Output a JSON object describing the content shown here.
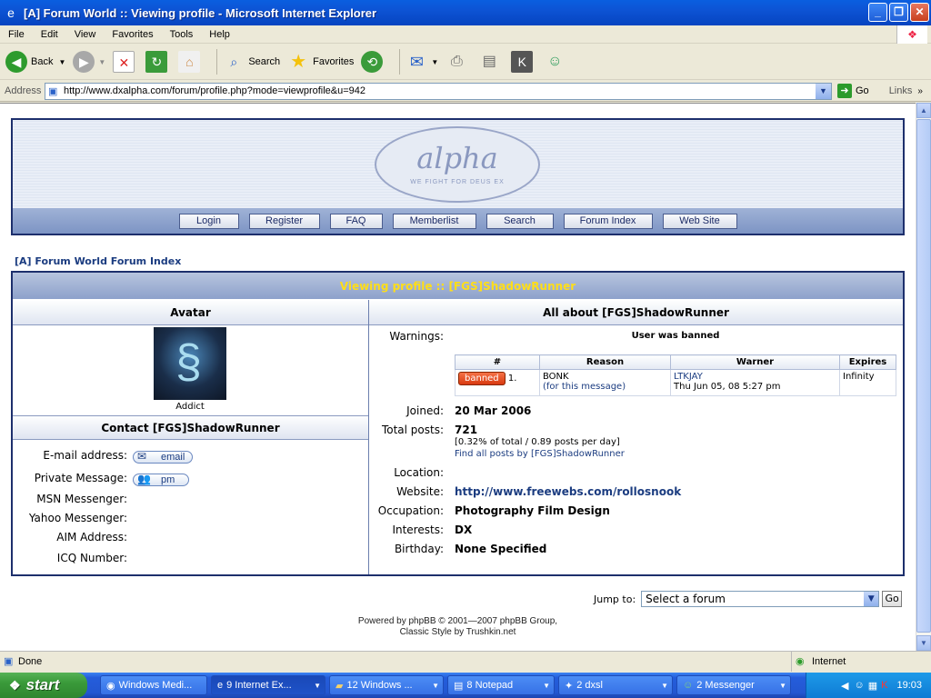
{
  "window": {
    "title": "[A] Forum World :: Viewing profile - Microsoft Internet Explorer"
  },
  "menu": [
    "File",
    "Edit",
    "View",
    "Favorites",
    "Tools",
    "Help"
  ],
  "toolbar": {
    "back": "Back",
    "search": "Search",
    "favorites": "Favorites"
  },
  "address": {
    "label": "Address",
    "url": "http://www.dxalpha.com/forum/profile.php?mode=viewprofile&u=942",
    "go": "Go",
    "links": "Links"
  },
  "site": {
    "logo_text": "alpha",
    "logo_slogan": "WE FIGHT FOR DEUS EX",
    "nav": [
      "Login",
      "Register",
      "FAQ",
      "Memberlist",
      "Search",
      "Forum Index",
      "Web Site"
    ],
    "index_link": "[A] Forum World Forum Index"
  },
  "profile": {
    "heading": "Viewing profile :: [FGS]ShadowRunner",
    "avatar_header": "Avatar",
    "rank": "Addict",
    "contact_header": "Contact [FGS]ShadowRunner",
    "contact": {
      "email_label": "E-mail address:",
      "email_btn": "email",
      "pm_label": "Private Message:",
      "pm_btn": "pm",
      "msn_label": "MSN Messenger:",
      "yahoo_label": "Yahoo Messenger:",
      "aim_label": "AIM Address:",
      "icq_label": "ICQ Number:"
    },
    "about_header": "All about [FGS]ShadowRunner",
    "warnings_label": "Warnings:",
    "warnings_status": "User was banned",
    "warn_table": {
      "headers": [
        "#",
        "Reason",
        "Warner",
        "Expires"
      ],
      "row": {
        "badge": "banned",
        "num": "1.",
        "reason": "BONK",
        "reason_link": "(for this message)",
        "warner": "LTKJAY",
        "warner_date": "Thu Jun 05, 08 5:27 pm",
        "expires": "Infinity"
      }
    },
    "joined_label": "Joined:",
    "joined": "20 Mar 2006",
    "posts_label": "Total posts:",
    "posts": "721",
    "posts_detail": "[0.32% of total / 0.89 posts per day]",
    "posts_link": "Find all posts by [FGS]ShadowRunner",
    "location_label": "Location:",
    "website_label": "Website:",
    "website": "http://www.freewebs.com/rollosnook",
    "occupation_label": "Occupation:",
    "occupation": "Photography Film Design",
    "interests_label": "Interests:",
    "interests": "DX",
    "birthday_label": "Birthday:",
    "birthday": "None Specified"
  },
  "jump": {
    "label": "Jump to:",
    "selected": "Select a forum",
    "go": "Go"
  },
  "footer": {
    "line1": "Powered by phpBB © 2001—2007 phpBB Group,",
    "line2": "Classic Style by Trushkin.net"
  },
  "status": {
    "text": "Done",
    "zone": "Internet"
  },
  "taskbar": {
    "start": "start",
    "tasks": [
      "Windows Medi...",
      "9 Internet Ex...",
      "12 Windows ...",
      "8 Notepad",
      "2 dxsl",
      "2 Messenger"
    ],
    "clock": "19:03"
  },
  "colors": {
    "accent_yellow": "#ffde18",
    "border_navy": "#1d2f6c",
    "link": "#1b3c80",
    "ban_red": "#d83a10"
  }
}
